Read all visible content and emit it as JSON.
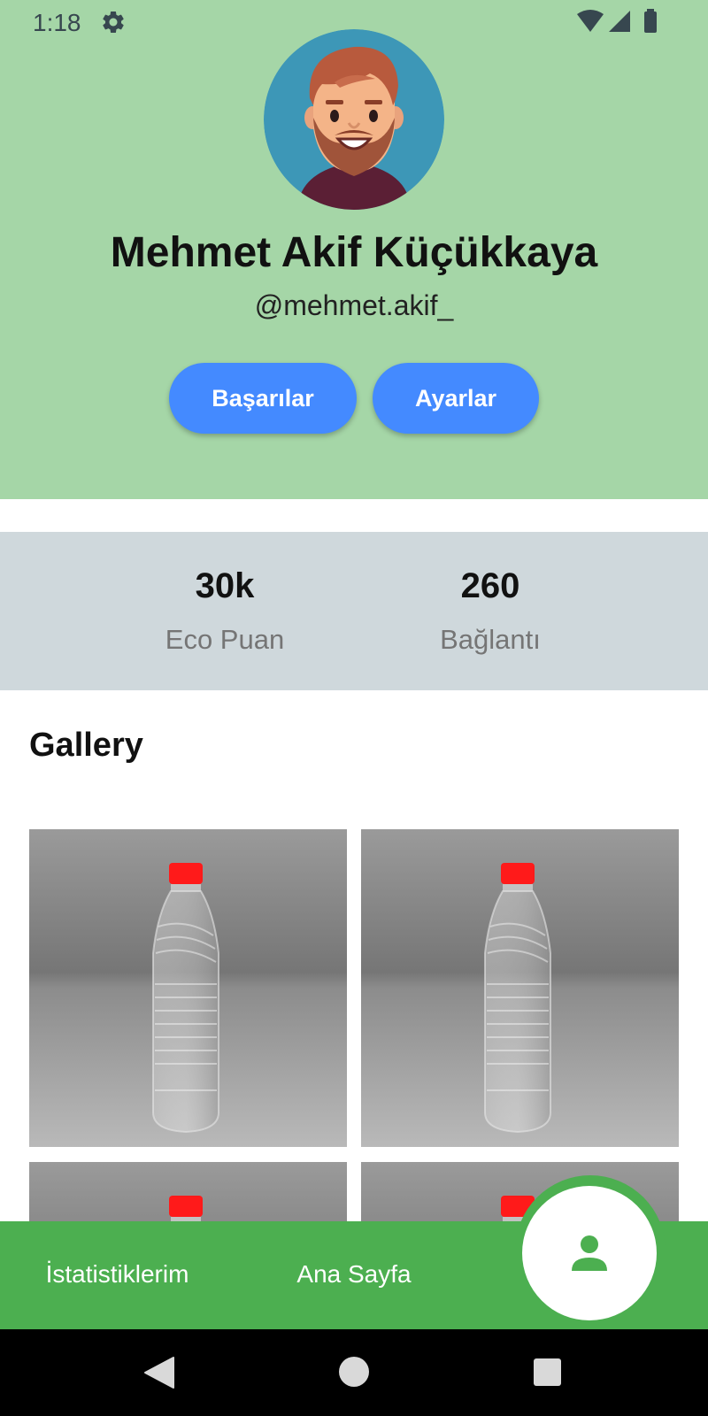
{
  "status_bar": {
    "time": "1:18",
    "left_icon": "gear-icon",
    "right_icons": [
      "wifi-icon",
      "signal-icon",
      "battery-icon"
    ]
  },
  "profile": {
    "name": "Mehmet Akif Küçükkaya",
    "handle": "@mehmet.akif_",
    "avatar": "avatar-illustration"
  },
  "actions": {
    "achievements_label": "Başarılar",
    "settings_label": "Ayarlar"
  },
  "stats": [
    {
      "value": "30k",
      "label": "Eco Puan"
    },
    {
      "value": "260",
      "label": "Bağlantı"
    }
  ],
  "gallery": {
    "title": "Gallery",
    "photos": [
      "plastic-bottle-photo",
      "plastic-bottle-photo",
      "plastic-bottle-photo",
      "plastic-bottle-photo"
    ]
  },
  "bottom_nav": {
    "items": [
      {
        "label": "İstatistiklerim"
      },
      {
        "label": "Ana Sayfa"
      }
    ],
    "active_icon": "person-icon"
  },
  "system_nav": [
    "back-icon",
    "home-icon",
    "recents-icon"
  ],
  "colors": {
    "header": "#a5d6a7",
    "accent_button": "#448aff",
    "stats_band": "#cfd8dc",
    "nav_bar": "#4caf50"
  }
}
